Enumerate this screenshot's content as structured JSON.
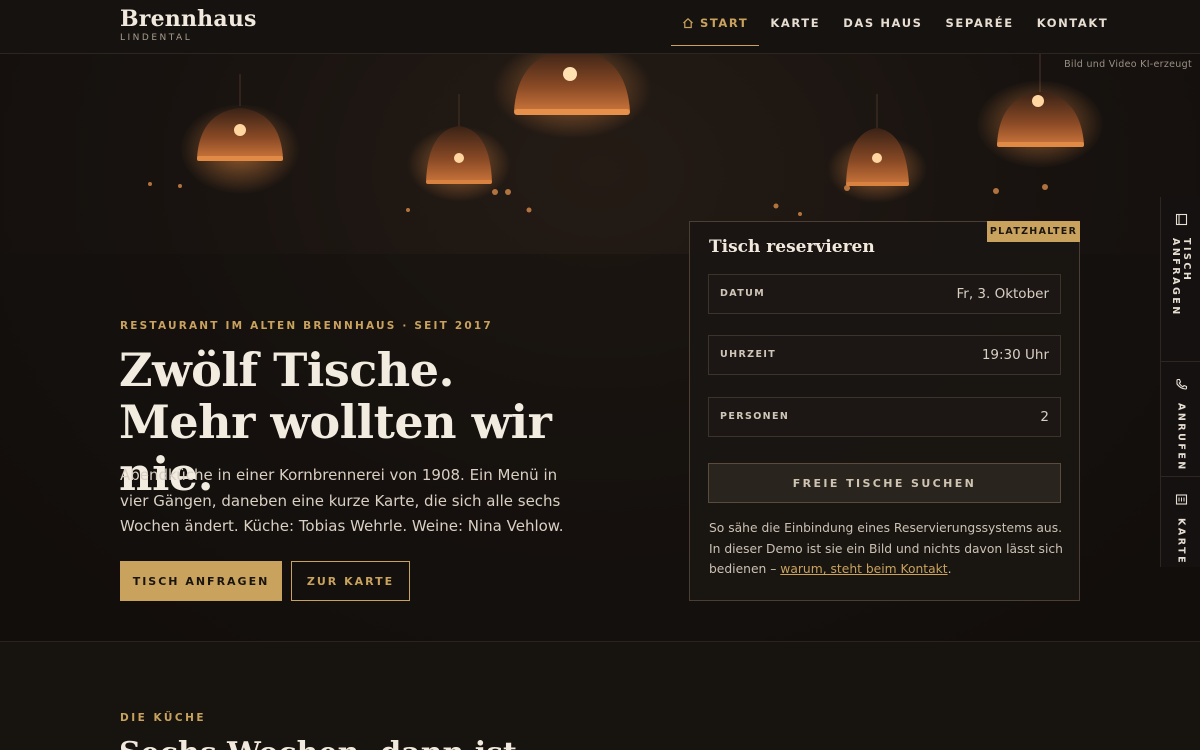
{
  "header": {
    "brand": "Brennhaus",
    "brand_sub": "LINDENTAL",
    "nav": [
      {
        "label": "START",
        "icon": "home-icon",
        "active": true
      },
      {
        "label": "KARTE"
      },
      {
        "label": "DAS HAUS"
      },
      {
        "label": "SEPARÉE"
      },
      {
        "label": "KONTAKT"
      }
    ]
  },
  "hero": {
    "ki_note": "Bild und Video KI-erzeugt",
    "eyebrow": "RESTAURANT IM ALTEN BRENNHAUS · SEIT 2017",
    "headline": "Zwölf Tische. Mehr wollten wir nie.",
    "lead": "Abendküche in einer Kornbrennerei von 1908. Ein Menü in vier Gängen, daneben eine kurze Karte, die sich alle sechs Wochen ändert. Küche: Tobias Wehrle. Weine: Nina Vehlow.",
    "primary_button": "TISCH ANFRAGEN",
    "secondary_button": "ZUR KARTE"
  },
  "reservation": {
    "badge": "PLATZHALTER",
    "title": "Tisch reservieren",
    "fields": [
      {
        "label": "DATUM",
        "value": "Fr, 3. Oktober"
      },
      {
        "label": "UHRZEIT",
        "value": "19:30 Uhr"
      },
      {
        "label": "PERSONEN",
        "value": "2"
      }
    ],
    "search_button": "FREIE TISCHE SUCHEN",
    "note_text": "So sähe die Einbindung eines Reservierungssystems aus. In dieser Demo ist sie ein Bild und nichts davon lässt sich bedienen – ",
    "note_link": "warum, steht beim Kontakt",
    "note_end": "."
  },
  "side_tabs": [
    {
      "label": "TISCH ANFRAGEN",
      "icon": "book-icon"
    },
    {
      "label": "ANRUFEN",
      "icon": "phone-icon"
    },
    {
      "label": "KARTE",
      "icon": "menu-card-icon"
    }
  ],
  "kitchen_section": {
    "eyebrow": "DIE KÜCHE",
    "title": "Sechs Wochen, dann ist"
  },
  "colors": {
    "accent": "#c9a25d",
    "background": "#15110f",
    "text": "#e8dfd3"
  }
}
